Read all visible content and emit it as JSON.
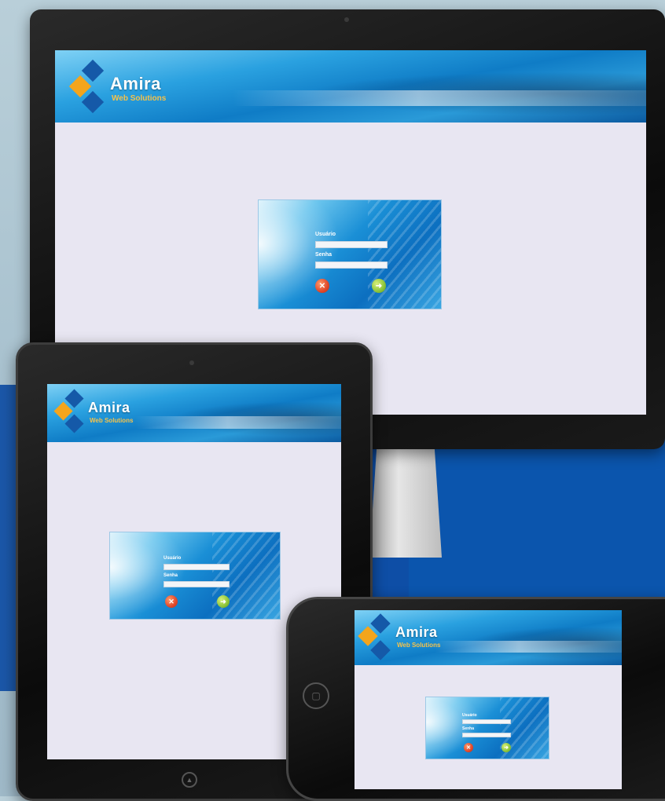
{
  "brand": {
    "name": "Amira",
    "tagline": "Web Solutions"
  },
  "login": {
    "username_label": "Usuário",
    "password_label": "Senha",
    "username_value": "",
    "password_value": "",
    "cancel_icon": "cancel-icon",
    "confirm_icon": "confirm-icon"
  },
  "devices": [
    "desktop-monitor",
    "tablet",
    "smartphone"
  ],
  "colors": {
    "screen_bg": "#e8e6f2",
    "brand_blue": "#1559a8",
    "brand_orange": "#f4a51c",
    "banner_blue": "#0f7cc6"
  }
}
